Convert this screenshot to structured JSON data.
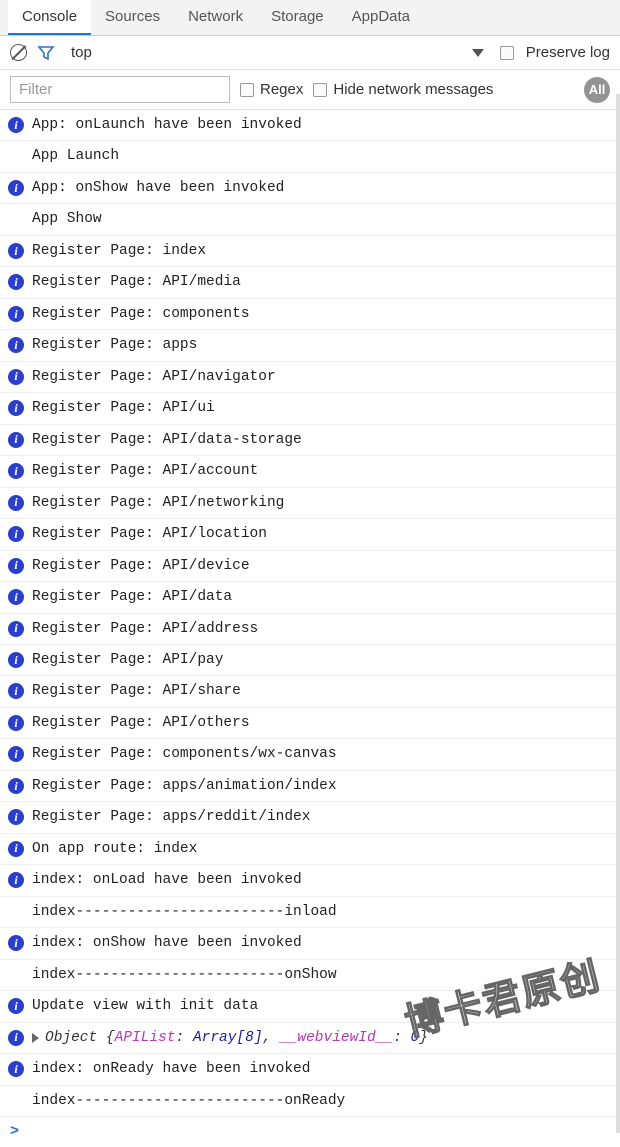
{
  "tabs": {
    "items": [
      {
        "label": "Console",
        "active": true
      },
      {
        "label": "Sources",
        "active": false
      },
      {
        "label": "Network",
        "active": false
      },
      {
        "label": "Storage",
        "active": false
      },
      {
        "label": "AppData",
        "active": false
      }
    ]
  },
  "toolbar": {
    "context": "top",
    "preserve_label": "Preserve log",
    "filter_placeholder": "Filter",
    "regex_label": "Regex",
    "hide_network_label": "Hide network messages",
    "all_label": "All"
  },
  "logs": [
    {
      "type": "info",
      "text": "App: onLaunch have been invoked"
    },
    {
      "type": "plain",
      "text": "App Launch"
    },
    {
      "type": "info",
      "text": "App: onShow have been invoked"
    },
    {
      "type": "plain",
      "text": "App Show"
    },
    {
      "type": "info",
      "text": "Register Page: index"
    },
    {
      "type": "info",
      "text": "Register Page: API/media"
    },
    {
      "type": "info",
      "text": "Register Page: components"
    },
    {
      "type": "info",
      "text": "Register Page: apps"
    },
    {
      "type": "info",
      "text": "Register Page: API/navigator"
    },
    {
      "type": "info",
      "text": "Register Page: API/ui"
    },
    {
      "type": "info",
      "text": "Register Page: API/data-storage"
    },
    {
      "type": "info",
      "text": "Register Page: API/account"
    },
    {
      "type": "info",
      "text": "Register Page: API/networking"
    },
    {
      "type": "info",
      "text": "Register Page: API/location"
    },
    {
      "type": "info",
      "text": "Register Page: API/device"
    },
    {
      "type": "info",
      "text": "Register Page: API/data"
    },
    {
      "type": "info",
      "text": "Register Page: API/address"
    },
    {
      "type": "info",
      "text": "Register Page: API/pay"
    },
    {
      "type": "info",
      "text": "Register Page: API/share"
    },
    {
      "type": "info",
      "text": "Register Page: API/others"
    },
    {
      "type": "info",
      "text": "Register Page: components/wx-canvas"
    },
    {
      "type": "info",
      "text": "Register Page: apps/animation/index"
    },
    {
      "type": "info",
      "text": "Register Page: apps/reddit/index"
    },
    {
      "type": "info",
      "text": "On app route: index"
    },
    {
      "type": "info",
      "text": "index: onLoad have been invoked"
    },
    {
      "type": "plain",
      "text": "index------------------------inload"
    },
    {
      "type": "info",
      "text": "index: onShow have been invoked"
    },
    {
      "type": "plain",
      "text": "index------------------------onShow"
    },
    {
      "type": "info",
      "text": "Update view with init data"
    },
    {
      "type": "object",
      "prefix": "Object {",
      "k1": "APIList",
      "v1": "Array[8]",
      "sep": ", ",
      "k2": "__webviewId__",
      "v2": "0",
      "suffix": "}"
    },
    {
      "type": "info",
      "text": "index: onReady have been invoked"
    },
    {
      "type": "plain",
      "text": "index------------------------onReady"
    }
  ],
  "prompt": ">",
  "watermark": "博卡君原创"
}
